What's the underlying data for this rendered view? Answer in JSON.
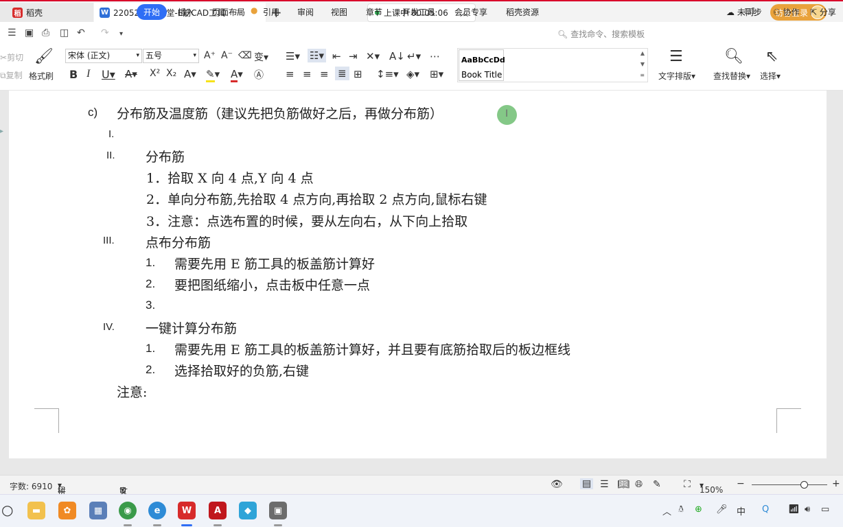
{
  "titlebar": {
    "tab1": "稻壳",
    "tab2": "220527E筋课堂-E筋CAD工具",
    "class_status": "上课中 00:05:06",
    "visitor_login": "访客登录"
  },
  "menu": {
    "items": [
      "开始",
      "插入",
      "页面布局",
      "引用",
      "审阅",
      "视图",
      "章节",
      "开发工具",
      "会员专享",
      "稻壳资源"
    ],
    "search_placeholder": "查找命令、搜索模板",
    "unsync": "未同步",
    "collab": "协作",
    "share": "分享"
  },
  "ribbon": {
    "cut": "剪切",
    "copy": "复制",
    "format_painter": "格式刷",
    "font_name": "宋体 (正文)",
    "font_size": "五号",
    "style_sample": "AaBbCcDd",
    "style_name": "Book Title",
    "text_layout": "文字排版",
    "find_replace": "查找替换",
    "select": "选择"
  },
  "document": {
    "heading_marker": "c)",
    "heading": "分布筋及温度筋（建议先把负筋做好之后，再做分布筋）",
    "item_I_marker": "I.",
    "item_II_marker": "II.",
    "item_II": "分布筋",
    "item_II_1": "1．拾取 X 向 4 点,Y 向 4 点",
    "item_II_2": "2．单向分布筋,先拾取 4 点方向,再拾取 2 点方向,鼠标右键",
    "item_II_3": "3．注意：点选布置的时候，要从左向右，从下向上拾取",
    "item_III_marker": "III.",
    "item_III": "点布分布筋",
    "item_III_1_num": "1.",
    "item_III_1": "需要先用 E 筋工具的板盖筋计算好",
    "item_III_2_num": "2.",
    "item_III_2": "要把图纸缩小，点击板中任意一点",
    "item_III_3_num": "3.",
    "item_IV_marker": "IV.",
    "item_IV": "一键计算分布筋",
    "item_IV_1_num": "1.",
    "item_IV_1": "需要先用 E 筋工具的板盖筋计算好，并且要有底筋拾取后的板边框线",
    "item_IV_2_num": "2.",
    "item_IV_2": "选择拾取好的负筋,右键",
    "note": "注意:"
  },
  "status": {
    "word_count": "字数: 6910",
    "spell_check": "拼写检查",
    "doc_proof": "文档校对",
    "zoom": "150%"
  },
  "colors": {
    "accent": "#2f6ef5",
    "wps_red": "#d72b2b",
    "visitor": "#e9a23b"
  }
}
